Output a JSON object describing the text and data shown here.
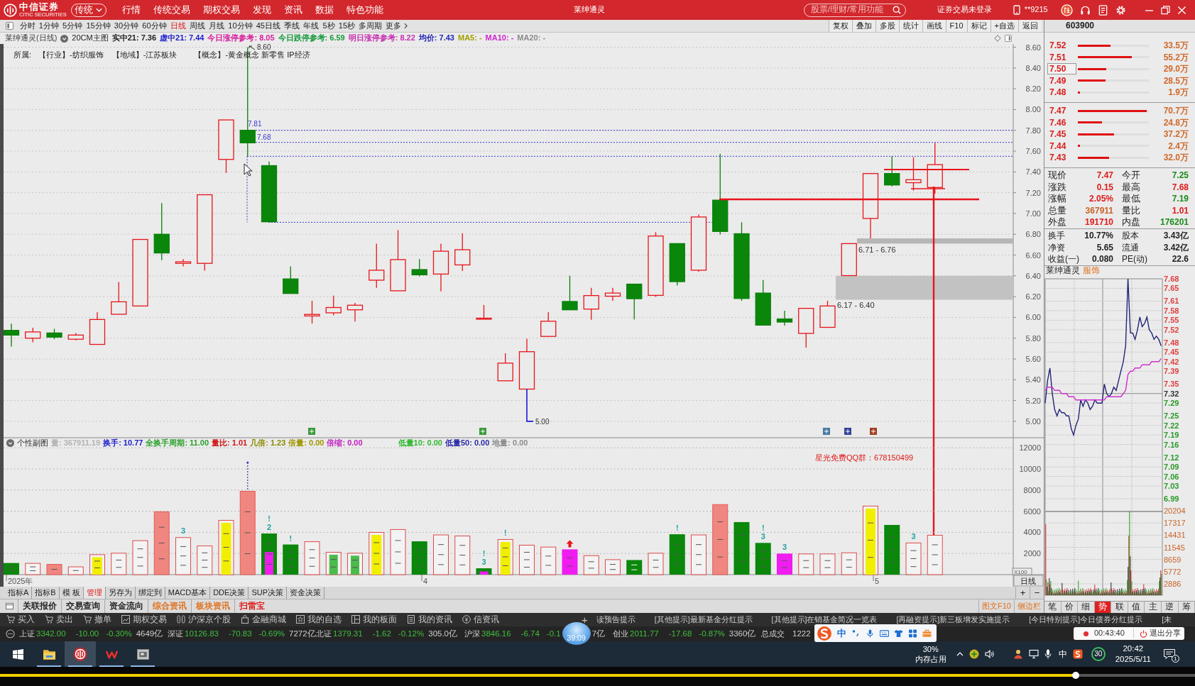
{
  "title_bar": {
    "logo": "中信证券",
    "logo_subtitle": "CITIC SECURITIES",
    "mode": "传统",
    "menu": [
      "行情",
      "传统交易",
      "期权交易",
      "发现",
      "资讯",
      "数据",
      "特色功能"
    ],
    "title": "莱绅通灵",
    "search": {
      "placeholder": "股票/理财/常用功能"
    },
    "login_status": "证券交易未登录",
    "account": "**9215"
  },
  "period_tabs": [
    {
      "label": "分时",
      "selected": false
    },
    {
      "label": "1分钟",
      "selected": false
    },
    {
      "label": "5分钟",
      "selected": false
    },
    {
      "label": "15分钟",
      "selected": false
    },
    {
      "label": "30分钟",
      "selected": false
    },
    {
      "label": "60分钟",
      "selected": false
    },
    {
      "label": "日线",
      "selected": true
    },
    {
      "label": "周线",
      "selected": false
    },
    {
      "label": "月线",
      "selected": false
    },
    {
      "label": "10分钟",
      "selected": false
    },
    {
      "label": "45日线",
      "selected": false
    },
    {
      "label": "季线",
      "selected": false
    },
    {
      "label": "年线",
      "selected": false
    },
    {
      "label": "5秒",
      "selected": false
    },
    {
      "label": "15秒",
      "selected": false
    },
    {
      "label": "多周期",
      "selected": false
    },
    {
      "label": "更多",
      "selected": false
    }
  ],
  "chart_tools": [
    "复权",
    "叠加",
    "多股",
    "统计",
    "画线",
    "F10",
    "标记",
    "+自选",
    "返回"
  ],
  "chart_info": {
    "title": "莱绅通灵(日线)",
    "template": "20CM主图",
    "items": [
      {
        "text": "实中21: 7.36",
        "color": "#222222"
      },
      {
        "text": "虚中21: 7.44",
        "color": "#1c1cd0"
      },
      {
        "text": "今日涨停参考: 8.05",
        "color": "#d81c9c"
      },
      {
        "text": "今日跌停参考: 6.59",
        "color": "#189a3c"
      },
      {
        "text": "明日涨停参考: 8.22",
        "color": "#c82fb0"
      },
      {
        "text": "均价: 7.43",
        "color": "#2424b8"
      },
      {
        "text": "MA5: -",
        "color": "#a0a000"
      },
      {
        "text": "MA10: -",
        "color": "#d028d0"
      },
      {
        "text": "MA20: -",
        "color": "#8c8c8c"
      }
    ]
  },
  "belongs": {
    "label": "所属:",
    "tags": [
      "【行业】-纺织服饰",
      "【地域】-江苏板块",
      "【概念】-黄金概念 新零售 IP经济"
    ]
  },
  "price_chart": {
    "axis": [
      "8.60",
      "8.40",
      "8.20",
      "8.00",
      "7.80",
      "7.60",
      "7.40",
      "7.20",
      "7.00",
      "6.80",
      "6.60",
      "6.40",
      "6.20",
      "6.00",
      "5.80",
      "5.60",
      "5.40",
      "5.20",
      "5.00"
    ],
    "annotations": [
      "8.60",
      "7.81",
      "7.68",
      "5.00"
    ],
    "zones": [
      "6.71 - 6.76",
      "6.17 - 6.40"
    ]
  },
  "volume_panel": {
    "title": "个性副图",
    "items": [
      {
        "text": "量: 367911.19",
        "color": "#b4b4b4"
      },
      {
        "text": "换手: 10.77",
        "color": "#1c1cd0"
      },
      {
        "text": "全换手周期: 11.00",
        "color": "#2aa02a"
      },
      {
        "text": "量比: 1.01",
        "color": "#d01818"
      },
      {
        "text": "几倍: 1.23",
        "color": "#8a8a00"
      },
      {
        "text": "倍量: 0.00",
        "color": "#a09600"
      },
      {
        "text": "倍缩: 0.00",
        "color": "#c020c0"
      },
      {
        "text": "低量10: 0.00",
        "color": "#30b830"
      },
      {
        "text": "低量50: 0.00",
        "color": "#2a2aa8"
      },
      {
        "text": "地量: 0.00",
        "color": "#8c8c8c"
      }
    ],
    "axis": [
      "12000",
      "10000",
      "8000",
      "6000",
      "4000",
      "2000"
    ],
    "unit": "X100",
    "notice": "星光免费QQ群：678150499",
    "marks": [
      "3",
      "!",
      "2",
      "!",
      "!",
      "3",
      "!",
      "!",
      "!",
      "3",
      "3",
      "3"
    ]
  },
  "date_axis": {
    "labels": [
      "2025年",
      "4",
      "5"
    ],
    "period": "日线"
  },
  "indicator_tabs": [
    {
      "label": "指标A",
      "selected": false
    },
    {
      "label": "指标B",
      "selected": false
    },
    {
      "label": "模 板",
      "selected": false
    },
    {
      "label": "管理",
      "selected": true
    },
    {
      "label": "另存为",
      "selected": false
    },
    {
      "label": "绑定到",
      "selected": false
    },
    {
      "label": "MACD基本",
      "selected": false
    },
    {
      "label": "DDE决策",
      "selected": false
    },
    {
      "label": "SUP决策",
      "selected": false
    },
    {
      "label": "资金决策",
      "selected": false
    }
  ],
  "zoom_buttons": [
    "+",
    "−"
  ],
  "info_tabs": [
    {
      "label": "关联报价",
      "color": "#222222"
    },
    {
      "label": "交易查询",
      "color": "#222222"
    },
    {
      "label": "资金流向",
      "color": "#222222"
    },
    {
      "label": "综合资讯",
      "color": "#e0701c"
    },
    {
      "label": "板块资讯",
      "color": "#e0701c"
    },
    {
      "label": "扫雷宝",
      "color": "#e01818"
    }
  ],
  "side_links": [
    "图文F10",
    "侧边栏"
  ],
  "quick_actions": [
    "买入",
    "卖出",
    "撤单",
    "期权交易",
    "沪深京个股",
    "金融商城",
    "我的自选",
    "我的板面",
    "我的资讯",
    "信资讯"
  ],
  "news_ticker": {
    "add": "+",
    "items": [
      "读预告提示",
      "[其他提示]最新基金分红提示",
      "[其他提示]在销基金简况一览表",
      "[再融资提示]新三板增发实施提示",
      "[今日特别提示]今日债券分红提示",
      "[未"
    ]
  },
  "index_bar": [
    {
      "name": "上证",
      "value": "3342.00",
      "change": "-10.00",
      "percent": "-0.30%",
      "amount": "4649亿"
    },
    {
      "name": "深证",
      "value": "10126.83",
      "change": "-70.83",
      "percent": "-0.69%",
      "amount": "7272亿"
    },
    {
      "name": "北证",
      "value": "1379.31",
      "change": "-1.62",
      "percent": "-0.12%",
      "amount": "305.0亿"
    },
    {
      "name": "沪深",
      "value": "3846.16",
      "change": "-6.74",
      "percent": "-0.1",
      "amount": "7亿"
    },
    {
      "name": "创业",
      "value": "2011.77",
      "change": "-17.68",
      "percent": "-0.87%",
      "amount": "3360亿"
    },
    {
      "name": "总成交",
      "value": "1222"
    }
  ],
  "right_panel": {
    "code": "603900",
    "asks": [
      {
        "price": "7.52",
        "volume": "33.5万",
        "level": 0.46,
        "highlighted": false
      },
      {
        "price": "7.51",
        "volume": "55.2万",
        "level": 0.76,
        "highlighted": false
      },
      {
        "price": "7.50",
        "volume": "29.0万",
        "level": 0.4,
        "highlighted": true
      },
      {
        "price": "7.49",
        "volume": "28.5万",
        "level": 0.39,
        "highlighted": false
      },
      {
        "price": "7.48",
        "volume": "1.9万",
        "level": 0.03,
        "highlighted": false
      }
    ],
    "bids": [
      {
        "price": "7.47",
        "volume": "70.7万",
        "level": 0.97,
        "highlighted": false
      },
      {
        "price": "7.46",
        "volume": "24.8万",
        "level": 0.34,
        "highlighted": false
      },
      {
        "price": "7.45",
        "volume": "37.2万",
        "level": 0.51,
        "highlighted": false
      },
      {
        "price": "7.44",
        "volume": "2.4万",
        "level": 0.03,
        "highlighted": false
      },
      {
        "price": "7.43",
        "volume": "32.0万",
        "level": 0.44,
        "highlighted": false
      }
    ],
    "quote": [
      {
        "label": "现价",
        "value": "7.47",
        "color": "#e01a1a"
      },
      {
        "label": "今开",
        "value": "7.25",
        "color": "#1a8c1a"
      },
      {
        "label": "涨跌",
        "value": "0.15",
        "color": "#e01a1a"
      },
      {
        "label": "最高",
        "value": "7.68",
        "color": "#e01a1a"
      },
      {
        "label": "涨幅",
        "value": "2.05%",
        "color": "#e01a1a"
      },
      {
        "label": "最低",
        "value": "7.19",
        "color": "#1a8c1a"
      },
      {
        "label": "总量",
        "value": "367911",
        "color": "#c8642a"
      },
      {
        "label": "量比",
        "value": "1.01",
        "color": "#e01a1a"
      },
      {
        "label": "外盘",
        "value": "191710",
        "color": "#e01a1a"
      },
      {
        "label": "内盘",
        "value": "176201",
        "color": "#1a8c1a"
      }
    ],
    "stats": [
      {
        "label": "换手",
        "value": "10.77%"
      },
      {
        "label": "股本",
        "value": "3.43亿"
      },
      {
        "label": "净资",
        "value": "5.65"
      },
      {
        "label": "流通",
        "value": "3.42亿"
      },
      {
        "label": "收益(一)",
        "value": "0.080"
      },
      {
        "label": "PE(动)",
        "value": "22.6"
      }
    ],
    "intraday": {
      "name": "莱绅通灵",
      "sector": "服饰",
      "chart_data": {
        "type": "line",
        "grid": true,
        "ylim": [
          6.95,
          7.68
        ],
        "yticks": [
          {
            "value": 7.68,
            "label": "7.68"
          },
          {
            "value": 7.65,
            "label": "7.65"
          },
          {
            "value": 7.61,
            "label": "7.61"
          },
          {
            "value": 7.58,
            "label": "7.58"
          },
          {
            "value": 7.55,
            "label": "7.55"
          },
          {
            "value": 7.52,
            "label": "7.52"
          },
          {
            "value": 7.48,
            "label": "7.48"
          },
          {
            "value": 7.45,
            "label": "7.45"
          },
          {
            "value": 7.42,
            "label": "7.42"
          },
          {
            "value": 7.39,
            "label": "7.39"
          },
          {
            "value": 7.35,
            "label": "7.35"
          },
          {
            "value": 7.32,
            "label": "7.32"
          },
          {
            "value": 7.29,
            "label": "7.29"
          },
          {
            "value": 7.25,
            "label": "7.25"
          },
          {
            "value": 7.22,
            "label": "7.22"
          },
          {
            "value": 7.19,
            "label": "7.19"
          },
          {
            "value": 7.16,
            "label": "7.16"
          },
          {
            "value": 7.12,
            "label": "7.12"
          },
          {
            "value": 7.09,
            "label": "7.09"
          },
          {
            "value": 7.06,
            "label": "7.06"
          },
          {
            "value": 7.03,
            "label": "7.03"
          },
          {
            "value": 6.99,
            "label": "6.99"
          }
        ],
        "series": [
          {
            "color": "#24247a",
            "values": [
              7.29,
              7.36,
              7.4,
              7.32,
              7.27,
              7.25,
              7.27,
              7.26,
              7.26,
              7.25,
              7.25,
              7.21,
              7.19,
              7.22,
              7.24,
              7.3,
              7.28,
              7.3,
              7.29,
              7.27,
              7.28,
              7.3,
              7.29,
              7.29,
              7.29,
              7.35,
              7.32,
              7.31,
              7.32,
              7.34,
              7.33,
              7.36,
              7.39,
              7.42,
              7.47,
              7.68,
              7.51,
              7.51,
              7.49,
              7.52,
              7.56,
              7.53,
              7.54,
              7.56,
              7.52,
              7.51,
              7.49,
              7.5,
              7.49,
              7.47
            ]
          },
          {
            "color": "#d030d0",
            "values": [
              7.33,
              7.34,
              7.34,
              7.34,
              7.33,
              7.33,
              7.33,
              7.32,
              7.32,
              7.32,
              7.31,
              7.31,
              7.31,
              7.3,
              7.3,
              7.3,
              7.3,
              7.3,
              7.3,
              7.3,
              7.3,
              7.3,
              7.3,
              7.3,
              7.3,
              7.3,
              7.31,
              7.31,
              7.31,
              7.31,
              7.31,
              7.31,
              7.31,
              7.32,
              7.33,
              7.38,
              7.39,
              7.39,
              7.4,
              7.4,
              7.4,
              7.41,
              7.41,
              7.41,
              7.41,
              7.42,
              7.42,
              7.42,
              7.42,
              7.43
            ]
          }
        ]
      },
      "volume_axis": [
        "20204",
        "17317",
        "14431",
        "11545",
        "8659",
        "5772",
        "2886"
      ]
    },
    "tabs": [
      {
        "label": "笔",
        "selected": false
      },
      {
        "label": "价",
        "selected": false
      },
      {
        "label": "细",
        "selected": false
      },
      {
        "label": "势",
        "selected": true
      },
      {
        "label": "联",
        "selected": false
      },
      {
        "label": "值",
        "selected": false
      },
      {
        "label": "主",
        "selected": false
      },
      {
        "label": "逆",
        "selected": false
      },
      {
        "label": "筹",
        "selected": false
      }
    ]
  },
  "overlays": {
    "timer": "39:09",
    "ime": "中",
    "recording": {
      "time": "00:43:40",
      "action": "退出分享"
    }
  },
  "taskbar": {
    "apps": [
      {
        "kind": "start",
        "selected": false,
        "running": false
      },
      {
        "kind": "folder",
        "selected": false,
        "running": true
      },
      {
        "kind": "broker",
        "selected": true,
        "running": true
      },
      {
        "kind": "office",
        "selected": false,
        "running": true
      },
      {
        "kind": "viewer",
        "selected": false,
        "running": true
      }
    ],
    "memory": "30%",
    "memory_label": "内存占用",
    "input_method": "中",
    "counter": "30",
    "time": "20:42",
    "date": "2025/5/11",
    "notifications": "1"
  },
  "video_progress": {
    "level": 0.9
  }
}
